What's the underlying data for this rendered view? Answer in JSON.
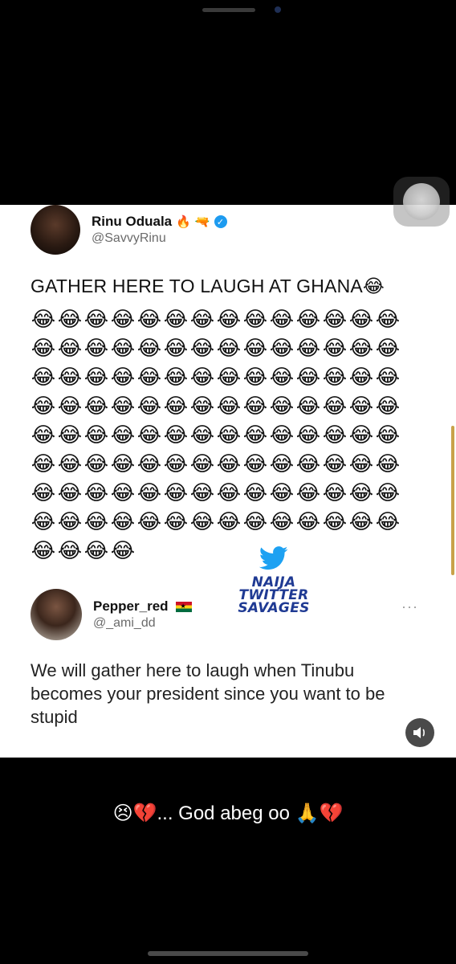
{
  "post": {
    "author": {
      "name": "Rinu Oduala",
      "handle": "@SavvyRinu",
      "badges": [
        "🔥",
        "🔫"
      ]
    },
    "text": "GATHER HERE TO LAUGH AT GHANA😂",
    "laugh_emoji": "😂",
    "laugh_count": 116
  },
  "watermark": {
    "lines": [
      "NAIJA",
      "TWITTER",
      "SAVAGES"
    ]
  },
  "reply": {
    "author": {
      "name": "Pepper_red",
      "handle": "@_ami_dd"
    },
    "text": "We will gather here to laugh when Tinubu becomes your president since you want to be stupid",
    "more_label": "···"
  },
  "caption": "😣💔... God abeg oo 🙏💔",
  "icons": {
    "verified": "verified-badge-icon",
    "watermark_logo": "twitter-bird-icon",
    "more": "more-options-icon",
    "sound": "speaker-icon"
  },
  "colors": {
    "verified": "#1d9bf0",
    "watermark": "#1f3a93",
    "bird": "#1da1f2",
    "background": "#000000",
    "card": "#ffffff"
  }
}
